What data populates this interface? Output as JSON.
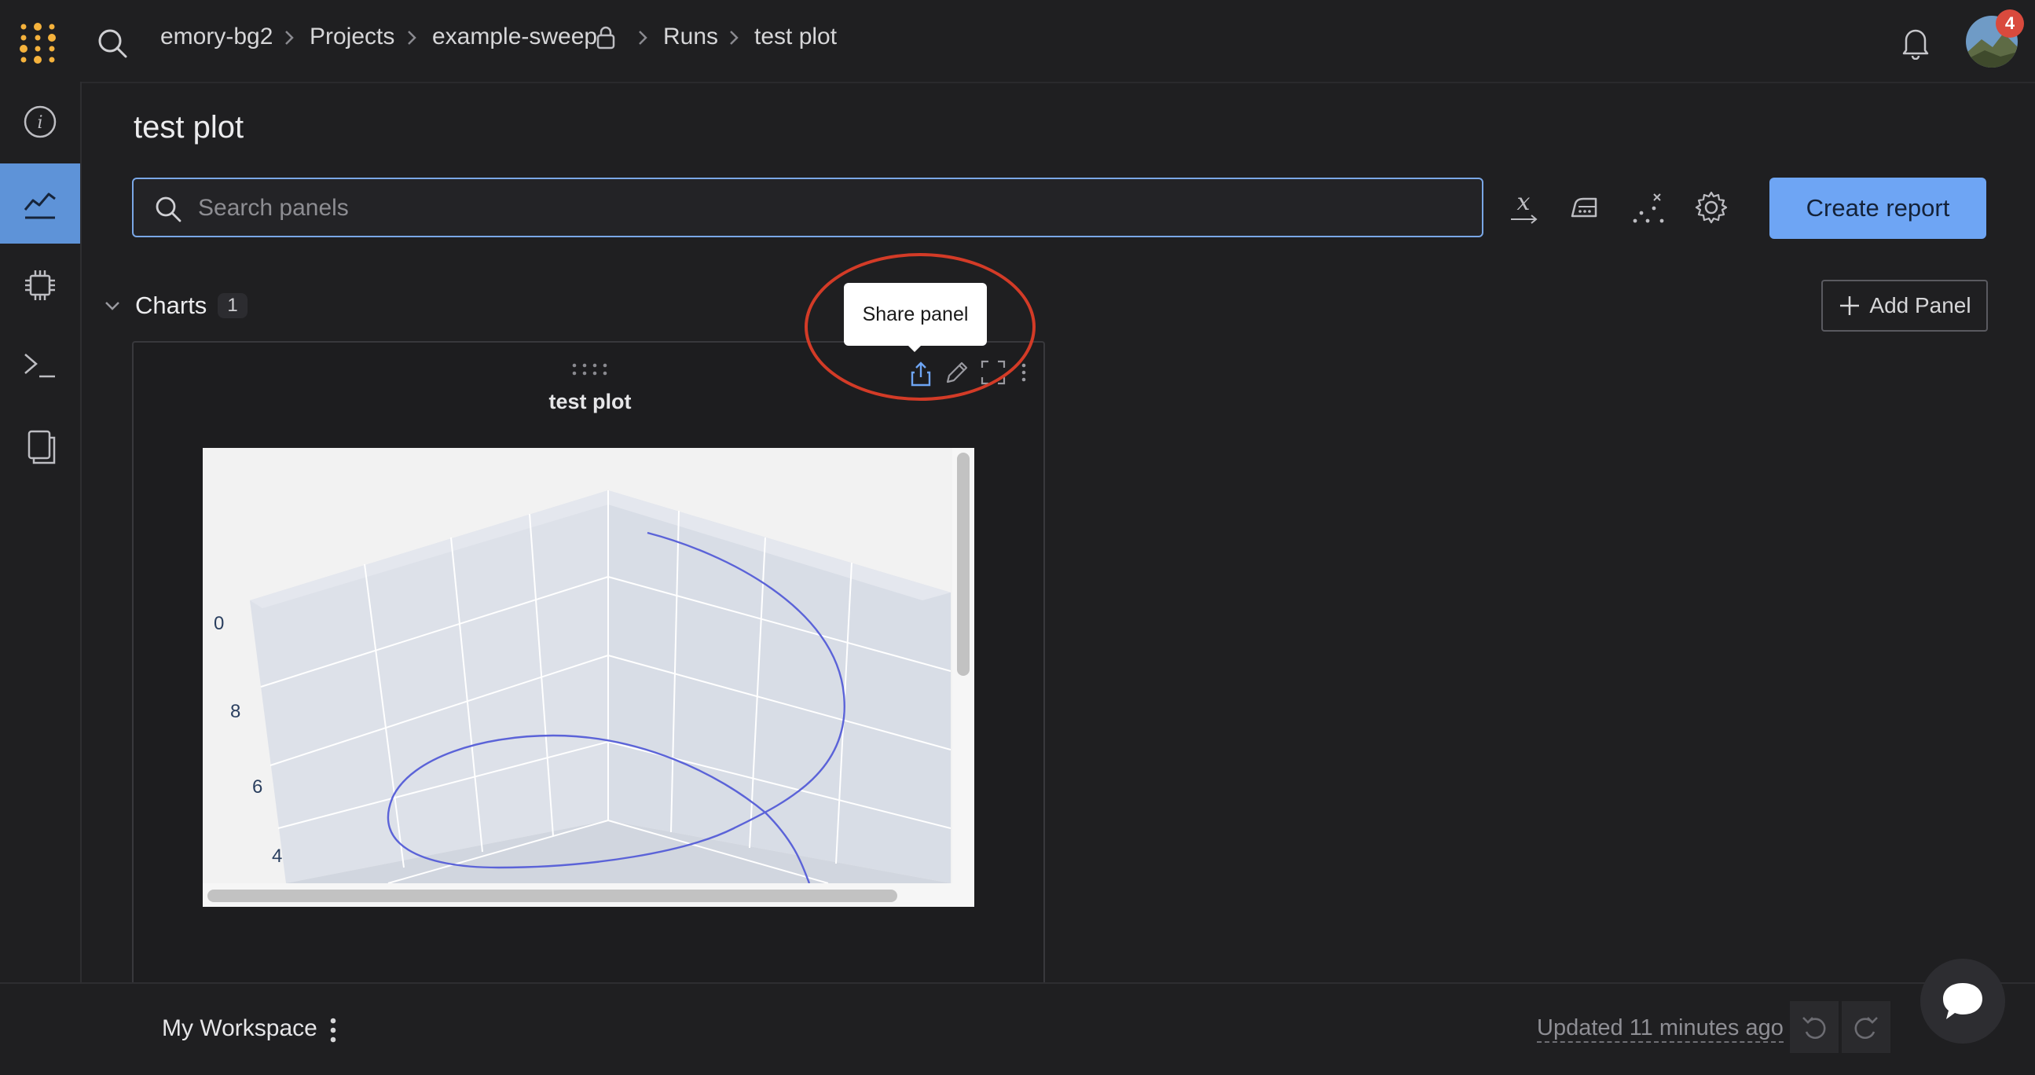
{
  "breadcrumb": {
    "items": [
      "emory-bg2",
      "Projects",
      "example-sweep",
      "Runs",
      "test plot"
    ]
  },
  "notifications": {
    "count": "4"
  },
  "page": {
    "title": "test plot"
  },
  "search": {
    "placeholder": "Search panels"
  },
  "toolbar": {
    "create_report_label": "Create report"
  },
  "section": {
    "label": "Charts",
    "count": "1",
    "add_panel_label": "Add Panel"
  },
  "panel": {
    "title": "test plot",
    "tooltip": "Share panel",
    "plot_tick_labels": [
      "0",
      "8",
      "6",
      "4"
    ]
  },
  "footer": {
    "workspace_label": "My Workspace",
    "updated_text": "Updated 11 minutes ago"
  },
  "colors": {
    "accent": "#6ea5f4",
    "active_rail": "#5e93d8",
    "highlight": "#d33b27",
    "logo": "#f5b23c"
  },
  "icons": [
    "logo-dots-icon",
    "search-icon",
    "lock-icon",
    "bell-icon",
    "info-icon",
    "chart-icon",
    "chip-icon",
    "terminal-icon",
    "files-icon",
    "formula-icon",
    "iron-icon",
    "scatter-icon",
    "gear-icon",
    "share-icon",
    "pencil-icon",
    "fullscreen-icon",
    "more-icon",
    "drag-handle-icon",
    "undo-icon",
    "redo-icon",
    "chat-icon",
    "plus-icon",
    "chevron-down-icon"
  ]
}
